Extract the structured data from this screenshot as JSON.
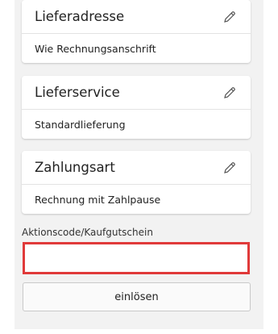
{
  "cards": [
    {
      "title": "Lieferadresse",
      "value": "Wie Rechnungsanschrift",
      "edit_icon": "pencil-icon"
    },
    {
      "title": "Lieferservice",
      "value": "Standardlieferung",
      "edit_icon": "pencil-icon"
    },
    {
      "title": "Zahlungsart",
      "value": "Rechnung mit Zahlpause",
      "edit_icon": "pencil-icon"
    }
  ],
  "promo": {
    "label": "Aktionscode/Kaufgutschein",
    "value": "",
    "redeem_label": "einlösen"
  },
  "colors": {
    "panel_background": "#f2f2f2",
    "error_border": "#e03a3a"
  }
}
